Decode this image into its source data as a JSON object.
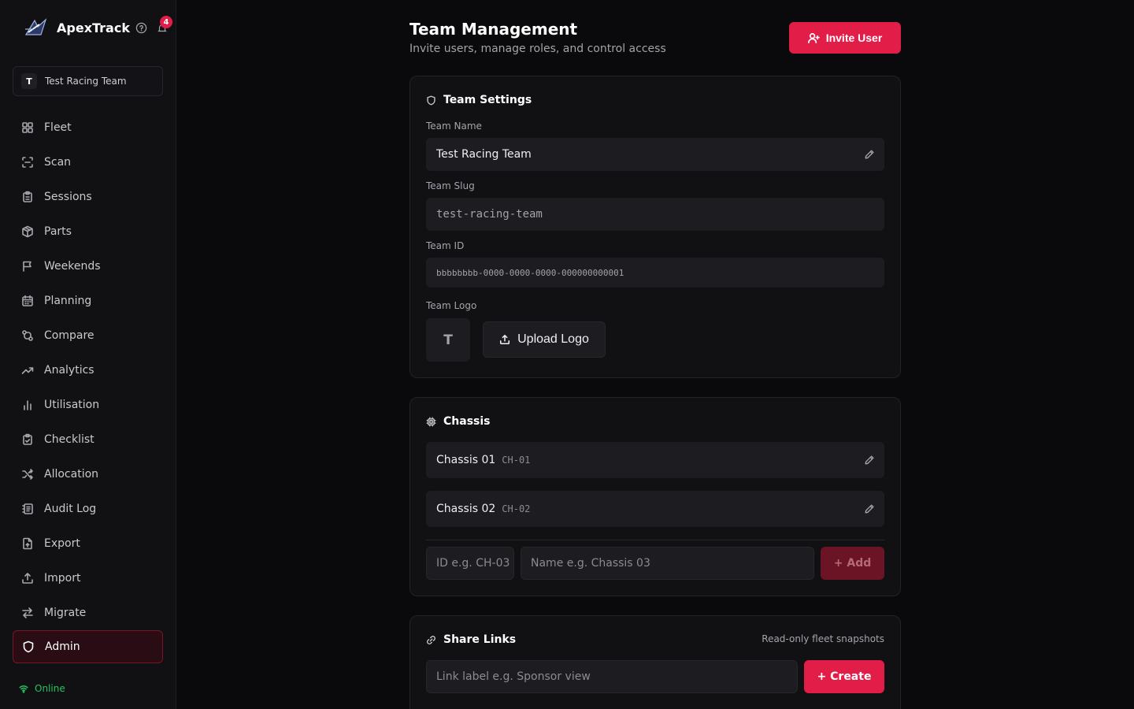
{
  "brand": {
    "name": "ApexTrack",
    "notification_count": "4"
  },
  "team_switcher": {
    "avatar": "T",
    "label": "Test Racing Team"
  },
  "nav": {
    "items": [
      {
        "label": "Fleet",
        "icon": "grid-icon"
      },
      {
        "label": "Scan",
        "icon": "scan-icon"
      },
      {
        "label": "Sessions",
        "icon": "clipboard-icon"
      },
      {
        "label": "Parts",
        "icon": "box-icon"
      },
      {
        "label": "Weekends",
        "icon": "flag-icon"
      },
      {
        "label": "Planning",
        "icon": "calendar-icon"
      },
      {
        "label": "Compare",
        "icon": "compare-icon"
      },
      {
        "label": "Analytics",
        "icon": "trend-icon"
      },
      {
        "label": "Utilisation",
        "icon": "bar-chart-icon"
      },
      {
        "label": "Checklist",
        "icon": "checklist-icon"
      },
      {
        "label": "Allocation",
        "icon": "shuffle-icon"
      },
      {
        "label": "Audit Log",
        "icon": "log-icon"
      },
      {
        "label": "Export",
        "icon": "file-export-icon"
      },
      {
        "label": "Import",
        "icon": "upload-icon"
      },
      {
        "label": "Migrate",
        "icon": "arrows-icon"
      },
      {
        "label": "Admin",
        "icon": "shield-icon",
        "active": true
      }
    ]
  },
  "status": {
    "label": "Online",
    "color": "#22c55e"
  },
  "header": {
    "title": "Team Management",
    "subtitle": "Invite users, manage roles, and control access",
    "invite_label": "Invite User"
  },
  "team_settings": {
    "title": "Team Settings",
    "name_label": "Team Name",
    "name_value": "Test Racing Team",
    "slug_label": "Team Slug",
    "slug_value": "test-racing-team",
    "id_label": "Team ID",
    "id_value": "bbbbbbbb-0000-0000-0000-000000000001",
    "logo_label": "Team Logo",
    "logo_initial": "T",
    "upload_label": "Upload Logo"
  },
  "chassis": {
    "title": "Chassis",
    "items": [
      {
        "name": "Chassis 01",
        "code": "CH-01"
      },
      {
        "name": "Chassis 02",
        "code": "CH-02"
      }
    ],
    "id_placeholder": "ID e.g. CH-03",
    "name_placeholder": "Name e.g. Chassis 03",
    "add_label": "+ Add"
  },
  "share_links": {
    "title": "Share Links",
    "note": "Read-only fleet snapshots",
    "label_placeholder": "Link label e.g. Sponsor view",
    "create_label": "+ Create"
  },
  "colors": {
    "accent": "#e11d48",
    "background": "#0a0a0c",
    "panel": "#111114"
  }
}
